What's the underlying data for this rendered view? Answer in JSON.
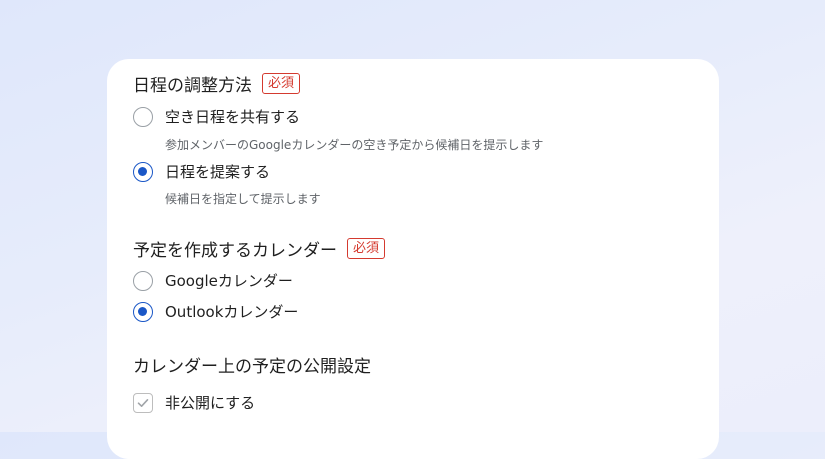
{
  "schedule_method": {
    "title": "日程の調整方法",
    "badge": "必須",
    "options": [
      {
        "label": "空き日程を共有する",
        "hint": "参加メンバーのGoogleカレンダーの空き予定から候補日を提示します",
        "checked": false
      },
      {
        "label": "日程を提案する",
        "hint": "候補日を指定して提示します",
        "checked": true
      }
    ]
  },
  "calendar": {
    "title": "予定を作成するカレンダー",
    "badge": "必須",
    "options": [
      {
        "label": "Googleカレンダー",
        "checked": false
      },
      {
        "label": "Outlookカレンダー",
        "checked": true
      }
    ]
  },
  "visibility": {
    "title": "カレンダー上の予定の公開設定",
    "checkbox_label": "非公開にする",
    "checked": true
  },
  "colors": {
    "accent": "#1a57c7",
    "required": "#d43a2f"
  }
}
